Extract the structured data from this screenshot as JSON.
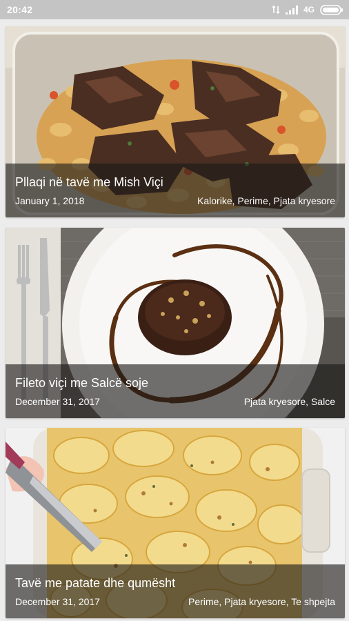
{
  "status_bar": {
    "time": "20:42",
    "network": "4G",
    "icons": [
      "data-transfer-icon",
      "signal-icon",
      "battery-icon"
    ]
  },
  "recipes": [
    {
      "title": "Pllaqi në tavë me Mish Viçi",
      "date": "January 1, 2018",
      "categories": "Kalorike, Perime, Pjata kryesore",
      "image": "baked-beans-with-beef-photo"
    },
    {
      "title": "Fileto viçi me Salcë soje",
      "date": "December 31, 2017",
      "categories": "Pjata kryesore, Salce",
      "image": "beef-fillet-with-soy-sauce-photo"
    },
    {
      "title": "Tavë me patate dhe qumësht",
      "date": "December 31, 2017",
      "categories": "Perime, Pjata kryesore, Te shpejta",
      "image": "potato-milk-casserole-photo"
    }
  ]
}
